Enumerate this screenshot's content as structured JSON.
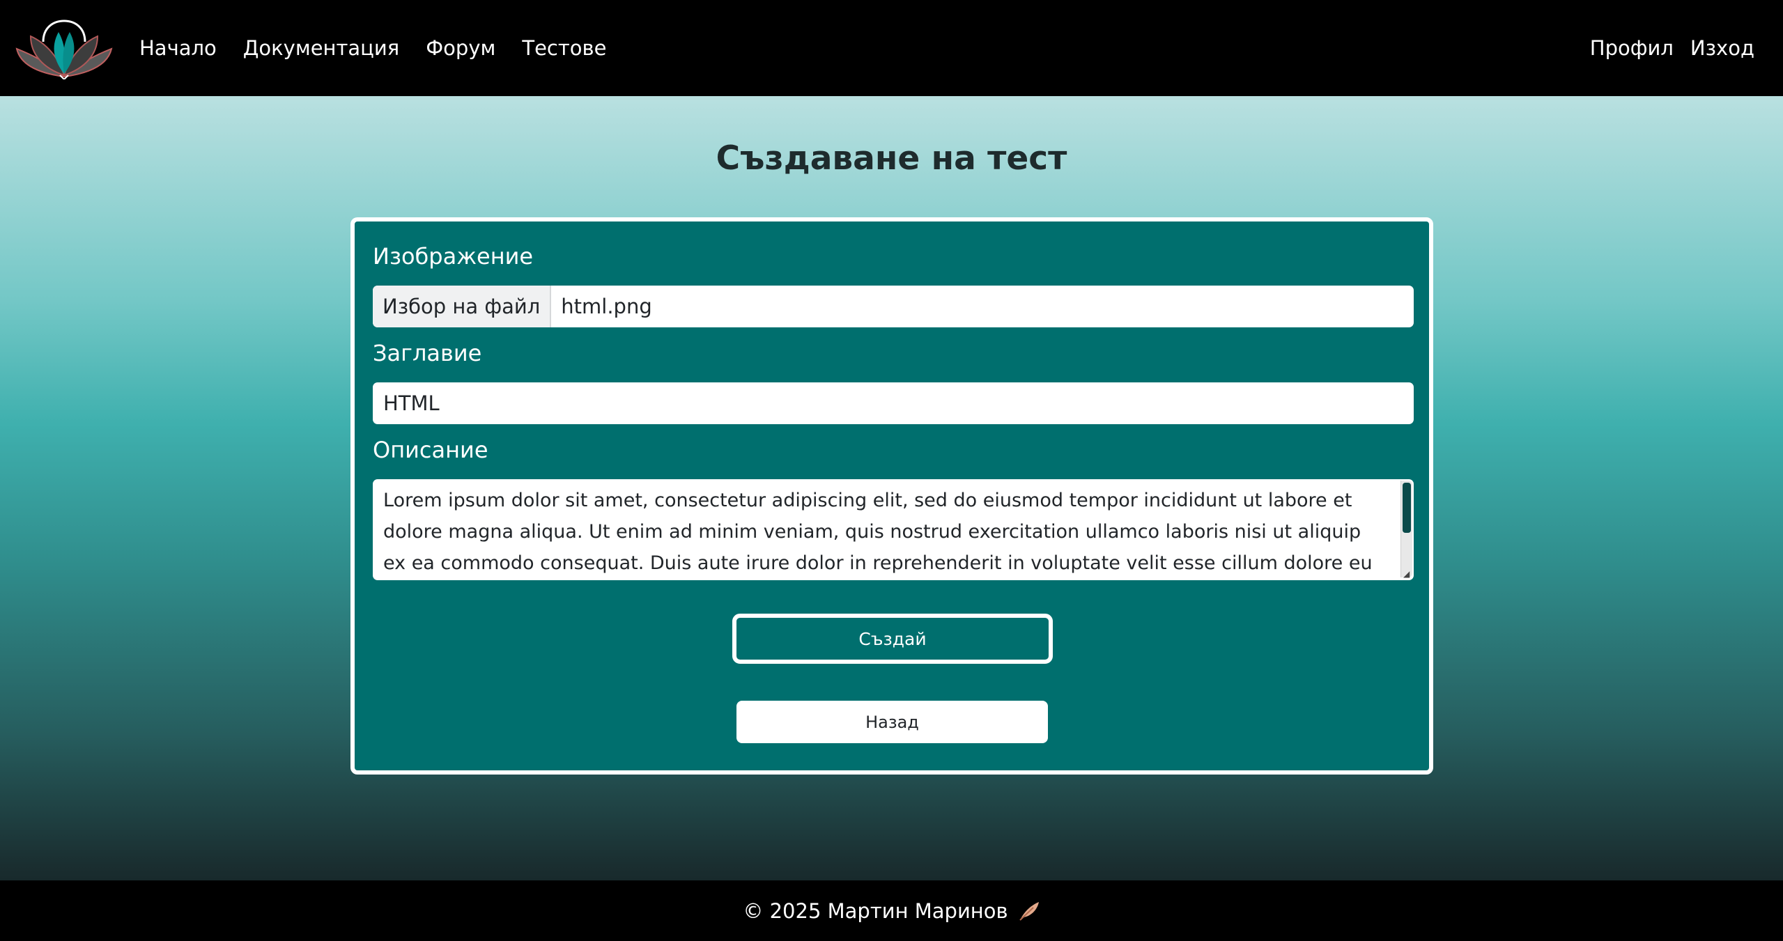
{
  "nav": {
    "links": [
      "Начало",
      "Документация",
      "Форум",
      "Тестове"
    ],
    "profile": "Профил",
    "logout": "Изход"
  },
  "page": {
    "title": "Създаване на тест"
  },
  "form": {
    "image_label": "Изображение",
    "file_button": "Избор на файл",
    "file_name": "html.png",
    "title_label": "Заглавие",
    "title_value": "HTML",
    "description_label": "Описание",
    "description_value": "Lorem ipsum dolor sit amet, consectetur adipiscing elit, sed do eiusmod tempor incididunt ut labore et dolore magna aliqua. Ut enim ad minim veniam, quis nostrud exercitation ullamco laboris nisi ut aliquip ex ea commodo consequat. Duis aute irure dolor in reprehenderit in voluptate velit esse cillum dolore eu fugiat",
    "create_button": "Създай",
    "back_button": "Назад"
  },
  "footer": {
    "text": "© 2025 Мартин Маринов"
  },
  "colors": {
    "nav_bg": "#000000",
    "card_bg": "#006f6e",
    "accent": "#00a7a5"
  },
  "icons": {
    "logo": "lotus-logo-icon",
    "footer": "feather-icon"
  }
}
